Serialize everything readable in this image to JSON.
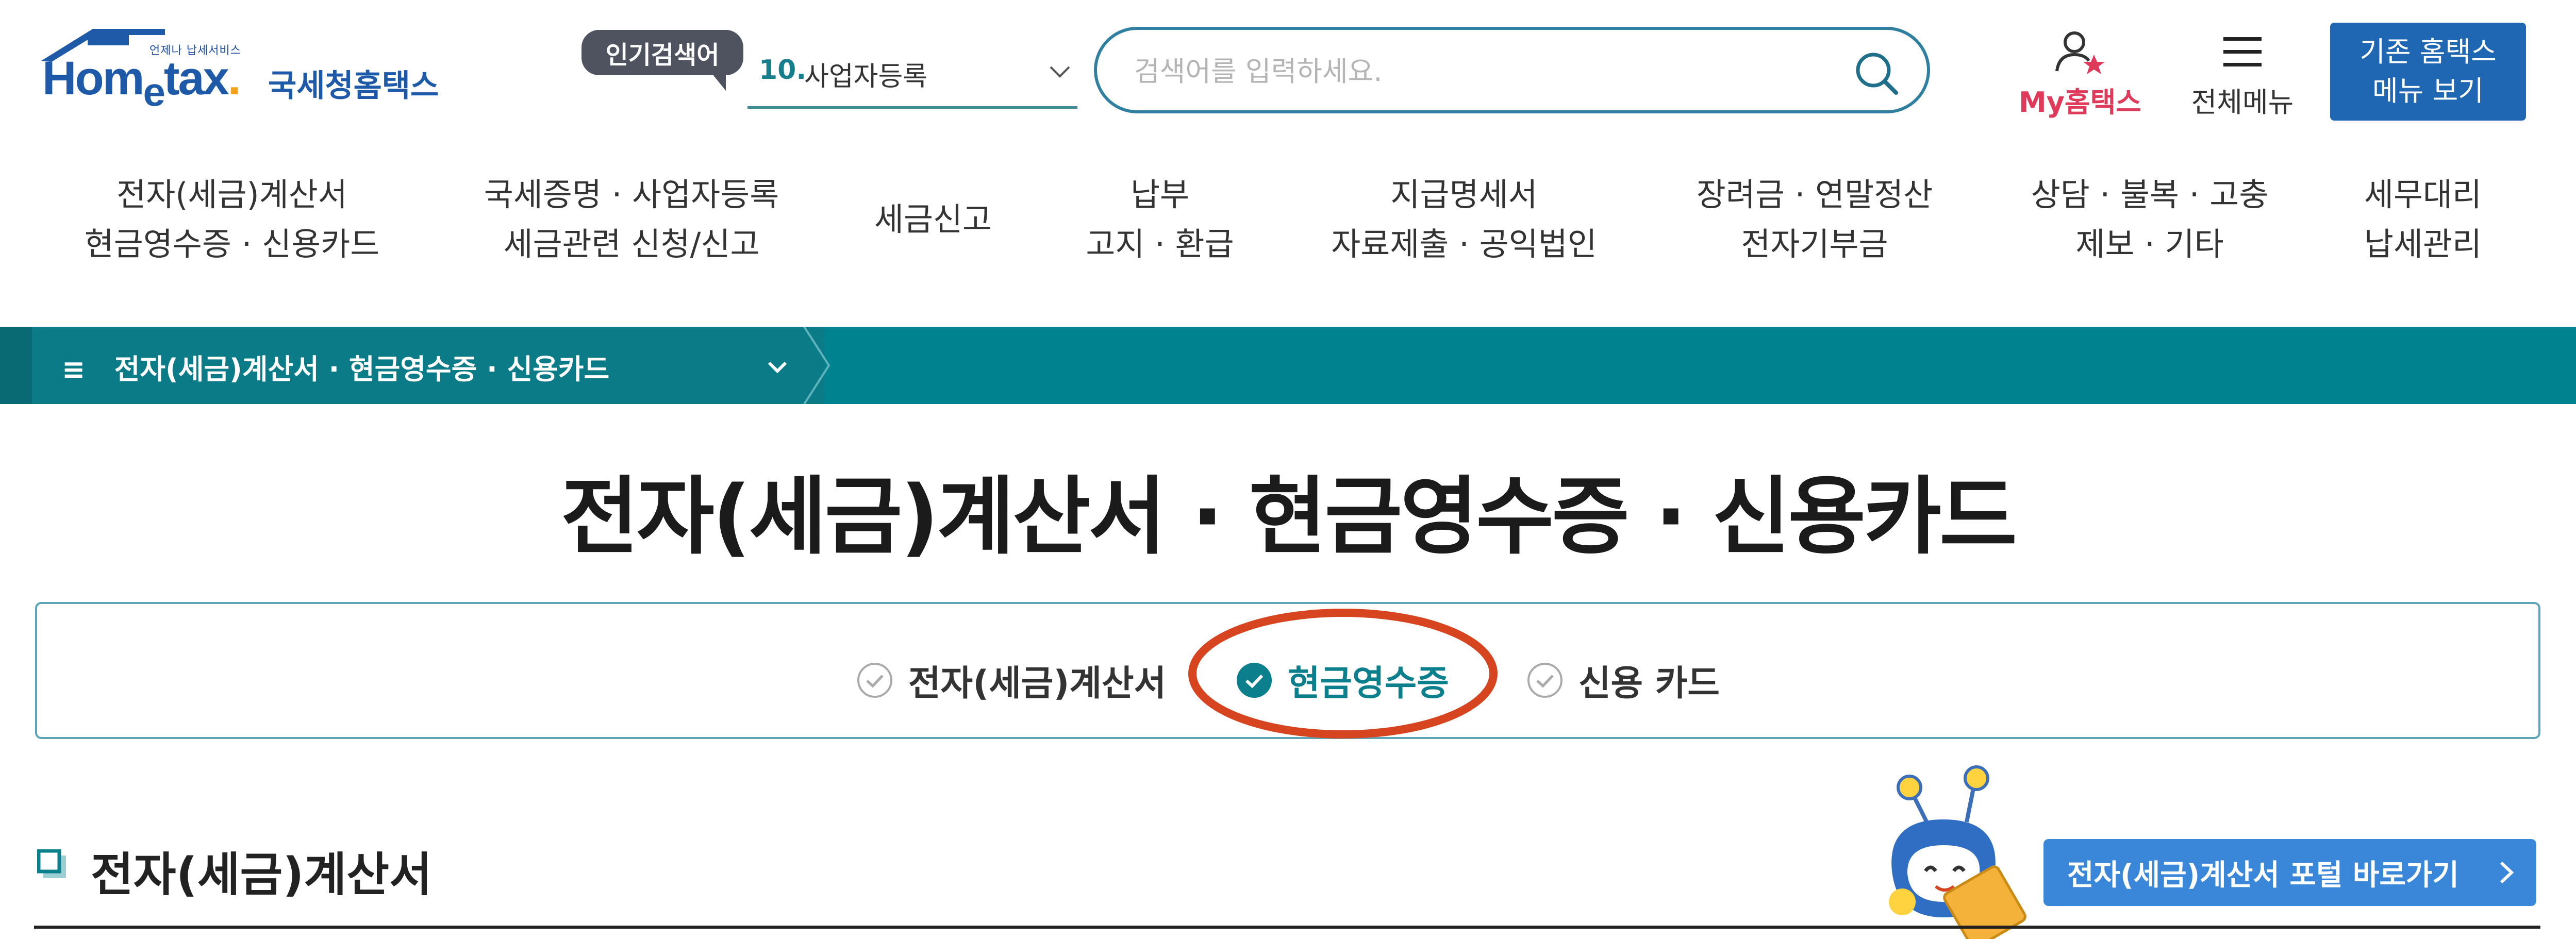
{
  "header": {
    "logo": {
      "tagline": "언제나 납세서비스",
      "wordmark": "Hometax.",
      "kr_name": "국세청홈택스"
    },
    "popular_search": {
      "badge": "인기검색어",
      "rank": "10.",
      "keyword": "사업자등록"
    },
    "search": {
      "placeholder": "검색어를 입력하세요."
    },
    "my_hometax": "My홈택스",
    "all_menu": "전체메뉴",
    "legacy_button": {
      "line1": "기존 홈택스",
      "line2": "메뉴 보기"
    }
  },
  "main_nav": [
    {
      "line1": "전자(세금)계산서",
      "line2": "현금영수증 · 신용카드"
    },
    {
      "line1": "국세증명 · 사업자등록",
      "line2": "세금관련 신청/신고"
    },
    {
      "line1": "세금신고",
      "line2": ""
    },
    {
      "line1": "납부",
      "line2": "고지 · 환급"
    },
    {
      "line1": "지급명세서",
      "line2": "자료제출 · 공익법인"
    },
    {
      "line1": "장려금 · 연말정산",
      "line2": "전자기부금"
    },
    {
      "line1": "상담 · 불복 · 고충",
      "line2": "제보 · 기타"
    },
    {
      "line1": "세무대리",
      "line2": "납세관리"
    }
  ],
  "breadcrumb": {
    "menu_glyph": "≡",
    "current": "전자(세금)계산서 · 현금영수증 · 신용카드"
  },
  "page_title": "전자(세금)계산서 · 현금영수증 · 신용카드",
  "tabs": [
    {
      "label": "전자(세금)계산서",
      "active": false
    },
    {
      "label": "현금영수증",
      "active": true
    },
    {
      "label": "신용 카드",
      "active": false
    }
  ],
  "section": {
    "title": "전자(세금)계산서",
    "portal_button": "전자(세금)계산서 포털 바로가기"
  },
  "colors": {
    "teal": "#00838f",
    "brand_blue": "#1f5aa8",
    "highlight_red": "#d6451f",
    "my_hometax_pink": "#e03a5b",
    "portal_blue": "#3a86d8"
  }
}
